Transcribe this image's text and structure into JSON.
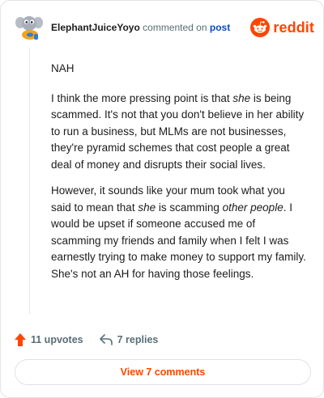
{
  "comment": {
    "author": "ElephantJuiceYoyo",
    "action_text": " commented on ",
    "post_link_text": "post",
    "brand_wordmark": "reddit",
    "paragraphs": {
      "p1": "NAH",
      "p2_a": "I think the more pressing point is that ",
      "p2_em": "she",
      "p2_b": " is being scammed. It's not that you don't believe in her ability to run a business, but MLMs are not businesses, they're pyramid schemes that cost people a great deal of money and disrupts their social lives.",
      "p3_a": "However, it sounds like your mum took what you said to mean that ",
      "p3_em1": "she",
      "p3_b": " is scamming ",
      "p3_em2": "other people",
      "p3_c": ". I would be upset if someone accused me of scamming my friends and family when I felt I was earnestly trying to make money to support my family. She's not an AH for having those feelings."
    },
    "upvotes_label": "11 upvotes",
    "replies_label": "7 replies",
    "view_comments_label": "View 7 comments"
  },
  "colors": {
    "accent": "#ff4500",
    "link": "#0a4bc6",
    "muted": "#576f76"
  },
  "icons": {
    "avatar": "elephant-avatar",
    "brand": "reddit-snoo-icon",
    "upvote": "upvote-arrow-icon",
    "reply": "reply-arrow-icon"
  }
}
